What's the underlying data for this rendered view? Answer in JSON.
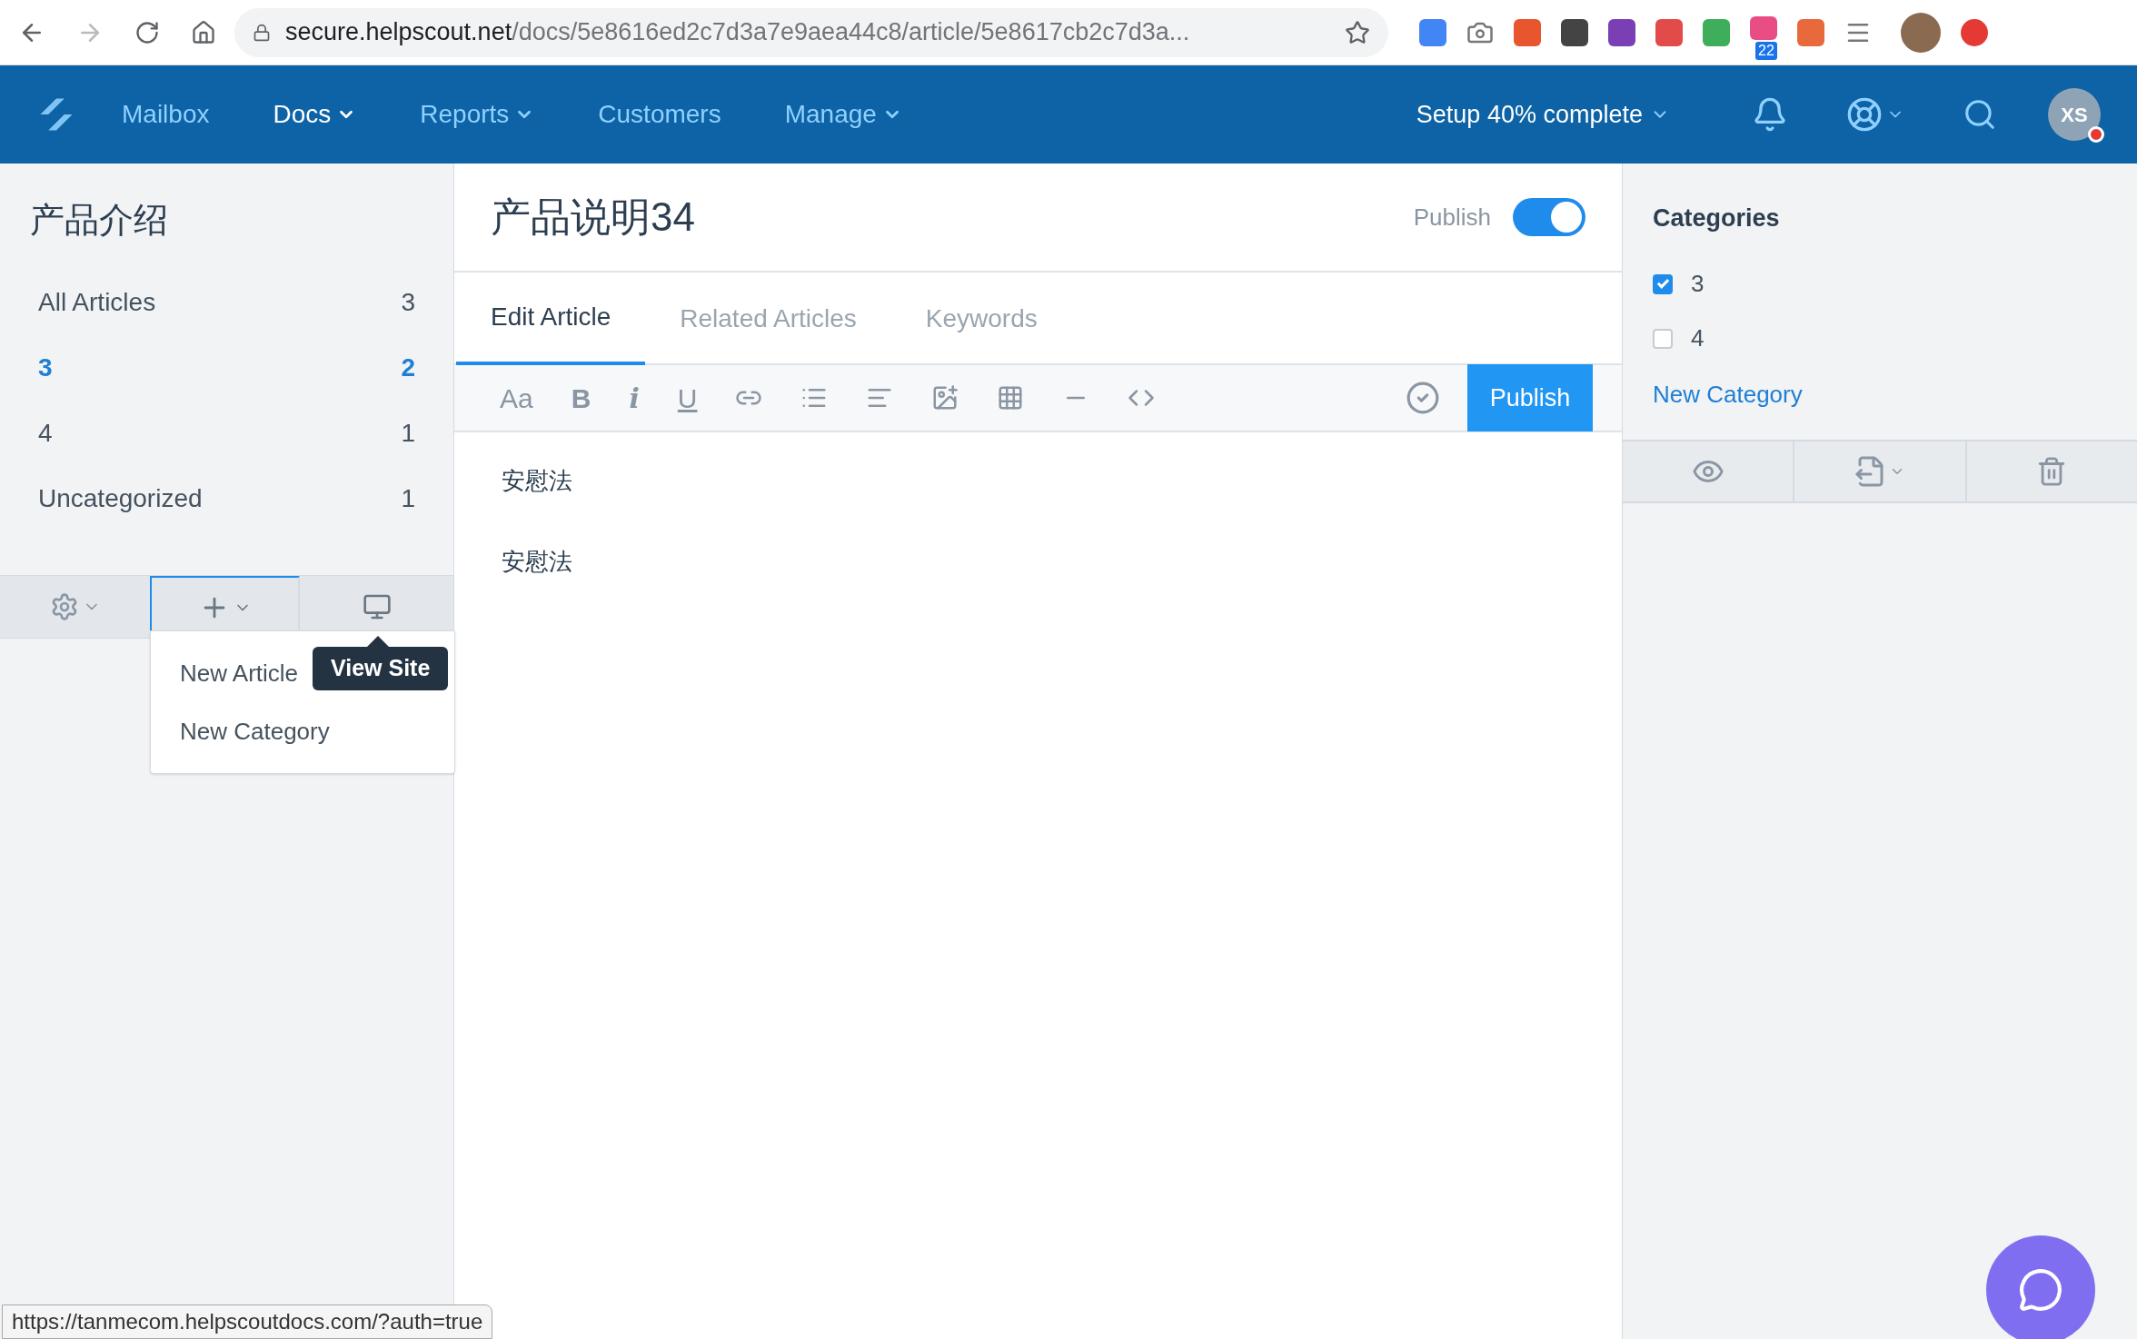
{
  "browser": {
    "url_host": "secure.helpscout.net",
    "url_path": "/docs/5e8616ed2c7d3a7e9aea44c8/article/5e8617cb2c7d3a...",
    "extension_badge": "22"
  },
  "nav": {
    "items": [
      {
        "label": "Mailbox",
        "selected": false,
        "dropdown": false
      },
      {
        "label": "Docs",
        "selected": true,
        "dropdown": true
      },
      {
        "label": "Reports",
        "selected": false,
        "dropdown": true
      },
      {
        "label": "Customers",
        "selected": false,
        "dropdown": false
      },
      {
        "label": "Manage",
        "selected": false,
        "dropdown": true
      }
    ],
    "setup": "Setup 40% complete",
    "avatar": "XS"
  },
  "sidebar": {
    "title": "产品介绍",
    "items": [
      {
        "label": "All Articles",
        "count": "3",
        "selected": false
      },
      {
        "label": "3",
        "count": "2",
        "selected": true
      },
      {
        "label": "4",
        "count": "1",
        "selected": false
      },
      {
        "label": "Uncategorized",
        "count": "1",
        "selected": false
      }
    ],
    "menu": [
      "New Article",
      "New Category"
    ],
    "tooltip": "View Site"
  },
  "article": {
    "title": "产品说明34",
    "publish_label": "Publish",
    "published": true,
    "tabs": [
      {
        "label": "Edit Article",
        "selected": true
      },
      {
        "label": "Related Articles",
        "selected": false
      },
      {
        "label": "Keywords",
        "selected": false
      }
    ],
    "toolbar": [
      {
        "kind": "text",
        "label": "Aa"
      },
      {
        "kind": "bold",
        "label": "B"
      },
      {
        "kind": "italic",
        "label": "i"
      },
      {
        "kind": "underline",
        "label": "U"
      },
      {
        "kind": "link"
      },
      {
        "kind": "list"
      },
      {
        "kind": "align"
      },
      {
        "kind": "image"
      },
      {
        "kind": "table"
      },
      {
        "kind": "rule"
      },
      {
        "kind": "code"
      }
    ],
    "publish_button": "Publish",
    "paragraphs": [
      "安慰法",
      "安慰法"
    ]
  },
  "categories": {
    "title": "Categories",
    "items": [
      {
        "label": "3",
        "checked": true
      },
      {
        "label": "4",
        "checked": false
      }
    ],
    "new_link": "New Category"
  },
  "status_url": "https://tanmecom.helpscoutdocs.com/?auth=true"
}
